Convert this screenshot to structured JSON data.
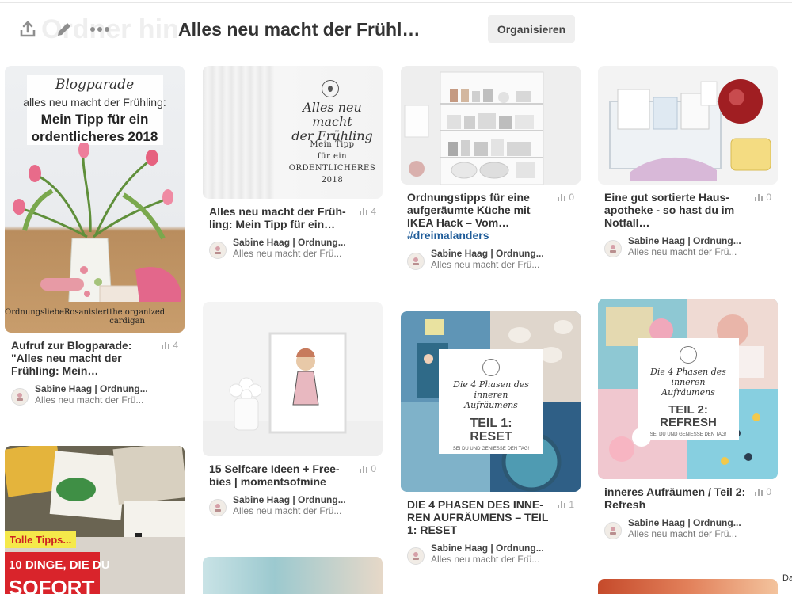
{
  "header": {
    "ghost_text": "Ordner hin",
    "board_title": "Alles neu macht der Frühl…",
    "organize_button": "Organisieren",
    "icons": [
      "upload-icon",
      "pencil-icon",
      "more-icon"
    ]
  },
  "pins": [
    {
      "title": "Aufruf zur Blogparade: \"Alles neu macht der Frühling: Mein…",
      "repins": "4",
      "pinner": "Sabine Haag | Ordnung...",
      "board": "Alles neu macht der Frü...",
      "image": {
        "script_line": "Blogparade",
        "line1": "alles neu macht der Frühling:",
        "line2": "Mein Tipp für ein",
        "line3": "ordentlicheres 2018",
        "footer_left": "Ordnungsliebe",
        "footer_mid": "Rosanisiert",
        "footer_right": "the organized cardigan"
      }
    },
    {
      "title": "Alles neu macht der Früh-ling: Mein Tipp für ein…",
      "repins": "4",
      "pinner": "Sabine Haag | Ordnung...",
      "board": "Alles neu macht der Frü...",
      "image": {
        "script1": "Alles neu macht",
        "script2": "der Frühling",
        "line1": "Mein Tipp",
        "line2": "für ein",
        "line3": "ordentlicheres",
        "line4": "2018"
      }
    },
    {
      "title_main": "Ordnungstipps für eine aufgeräumte Küche mit IKEA Hack – Vom…",
      "hashtag": "#dreimalanders",
      "repins": "0",
      "pinner": "Sabine Haag | Ordnung...",
      "board": "Alles neu macht der Frü..."
    },
    {
      "title": "Eine gut sortierte Haus-apotheke - so hast du im Notfall…",
      "repins": "0",
      "pinner": "Sabine Haag | Ordnung...",
      "board": "Alles neu macht der Frü..."
    },
    {
      "title": "15 Selfcare Ideen + Free-bies | momentsofmine",
      "repins": "0",
      "pinner": "Sabine Haag | Ordnung...",
      "board": "Alles neu macht der Frü..."
    },
    {
      "title": "DIE 4 PHASEN DES INNE-REN AUFRÄUMENS – TEIL 1: RESET",
      "repins": "1",
      "pinner": "Sabine Haag | Ordnung...",
      "board": "Alles neu macht der Frü...",
      "image": {
        "script": "Die 4 Phasen des inneren Aufräumens",
        "big1": "TEIL 1:",
        "big2": "RESET",
        "small": "SEI DU UND GENIESSE DEN TAG!"
      }
    },
    {
      "title": "inneres Aufräumen / Teil 2: Refresh",
      "repins": "0",
      "pinner": "Sabine Haag | Ordnung...",
      "board": "Alles neu macht der Frü...",
      "image": {
        "script": "Die 4 Phasen des inneren Aufräumens",
        "big1": "TEIL 2:",
        "big2": "REFRESH",
        "small": "SEI DU UND GENIESSE DEN TAG!"
      }
    },
    {
      "image": {
        "banner": "Tolle Tipps...",
        "big1": "10 DINGE, DIE DU",
        "big2": "SOFORT"
      }
    }
  ],
  "footer_peek": "Da"
}
